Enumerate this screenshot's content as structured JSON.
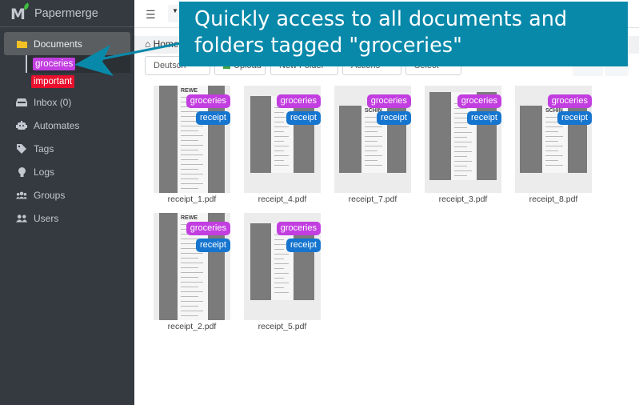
{
  "app": {
    "name": "Papermerge",
    "brand_colors": {
      "sidebar_bg": "#343a40",
      "callout_bg": "#0989aa",
      "tag_groceries": "#c23ee0",
      "tag_receipt": "#1575cf",
      "tag_important": "#e8102c"
    }
  },
  "sidebar": {
    "items": [
      {
        "label": "Documents",
        "icon": "folder-icon",
        "active": true
      },
      {
        "label": "Inbox (0)",
        "icon": "inbox-icon"
      },
      {
        "label": "Automates",
        "icon": "robot-icon"
      },
      {
        "label": "Tags",
        "icon": "tag-icon"
      },
      {
        "label": "Logs",
        "icon": "lightbulb-icon"
      },
      {
        "label": "Groups",
        "icon": "users-group-icon"
      },
      {
        "label": "Users",
        "icon": "user-friends-icon"
      }
    ],
    "tags": [
      {
        "label": "groceries",
        "color": "#c23ee0",
        "selected": true
      },
      {
        "label": "important",
        "color": "#e8102c",
        "selected": false
      }
    ]
  },
  "topbar": {
    "menu_icon": "hamburger-icon",
    "dropdown_icon": "caret-down-icon"
  },
  "breadcrumb": {
    "home": "Home"
  },
  "toolbar": {
    "language": "Deutsch",
    "upload": "Upload",
    "new_folder": "New Folder",
    "actions": "Actions",
    "select": "Select"
  },
  "documents": [
    {
      "name": "receipt_1.pdf",
      "tags": [
        "groceries",
        "receipt"
      ],
      "header": "REWE"
    },
    {
      "name": "receipt_4.pdf",
      "tags": [
        "groceries",
        "receipt"
      ],
      "header": ""
    },
    {
      "name": "receipt_7.pdf",
      "tags": [
        "groceries",
        "receipt"
      ],
      "header": "SCHIN"
    },
    {
      "name": "receipt_3.pdf",
      "tags": [
        "groceries",
        "receipt"
      ],
      "header": ""
    },
    {
      "name": "receipt_8.pdf",
      "tags": [
        "groceries",
        "receipt"
      ],
      "header": "SCHIN"
    },
    {
      "name": "receipt_2.pdf",
      "tags": [
        "groceries",
        "receipt"
      ],
      "header": "REWE"
    },
    {
      "name": "receipt_5.pdf",
      "tags": [
        "groceries",
        "receipt"
      ],
      "header": ""
    }
  ],
  "callout": {
    "line1": "Quickly access to all documents  and",
    "line2": "folders tagged \"groceries\""
  }
}
